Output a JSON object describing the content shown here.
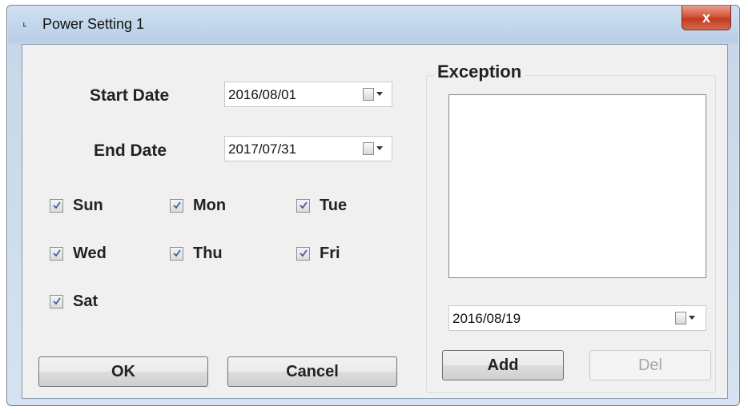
{
  "window": {
    "title": "Power Setting 1",
    "close_glyph": "x"
  },
  "form": {
    "start_date_label": "Start Date",
    "start_date_value": "2016/08/01",
    "end_date_label": "End Date",
    "end_date_value": "2017/07/31"
  },
  "days": [
    {
      "label": "Sun",
      "checked": true
    },
    {
      "label": "Mon",
      "checked": true
    },
    {
      "label": "Tue",
      "checked": true
    },
    {
      "label": "Wed",
      "checked": true
    },
    {
      "label": "Thu",
      "checked": true
    },
    {
      "label": "Fri",
      "checked": true
    },
    {
      "label": "Sat",
      "checked": true
    }
  ],
  "buttons": {
    "ok": "OK",
    "cancel": "Cancel"
  },
  "exception": {
    "title": "Exception",
    "items": [],
    "date_value": "2016/08/19",
    "add_label": "Add",
    "del_label": "Del"
  },
  "colors": {
    "close_button": "#c9432a",
    "client_background": "#f0f0f0",
    "checkmark": "#3a5f9e"
  }
}
